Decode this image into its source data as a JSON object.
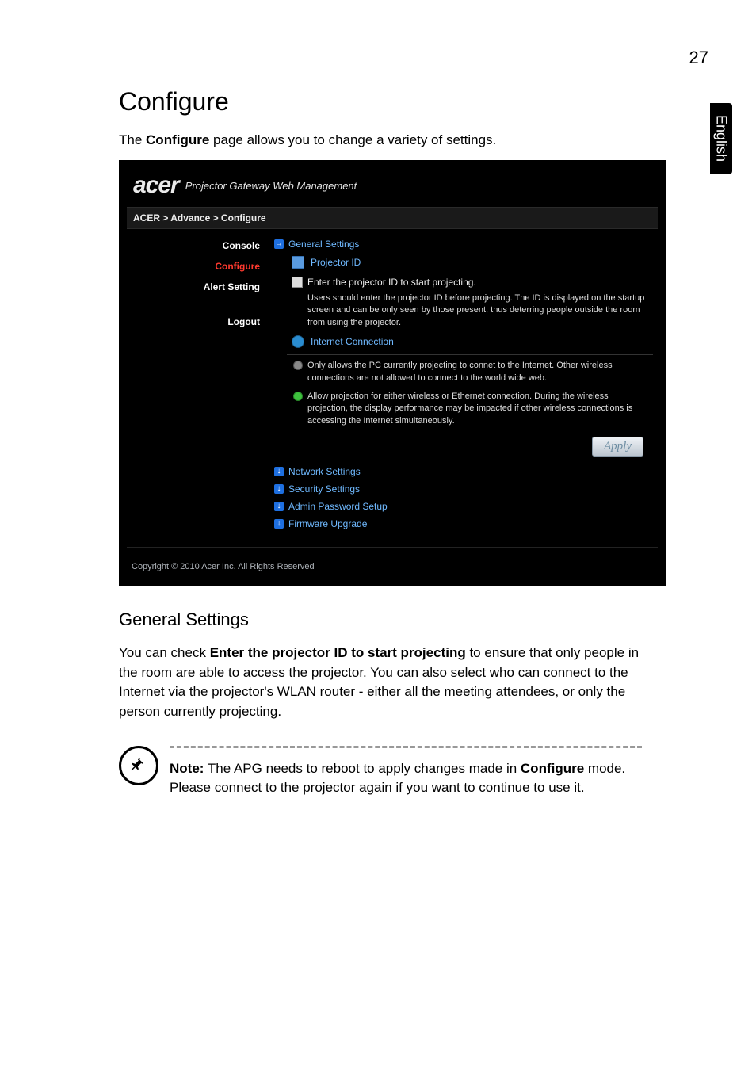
{
  "page_number": "27",
  "side_tab": "English",
  "title": "Configure",
  "intro_pre": "The ",
  "intro_bold": "Configure",
  "intro_post": " page allows you to change a variety of settings.",
  "webui": {
    "logo": "acer",
    "subtitle": "Projector Gateway Web Management",
    "breadcrumb": "ACER > Advance > Configure",
    "nav": {
      "console": "Console",
      "configure": "Configure",
      "alert": "Alert Setting",
      "logout": "Logout"
    },
    "sections": {
      "general": "General Settings",
      "projector_id": "Projector ID",
      "opt_checkbox": "Enter the projector ID to start projecting.",
      "opt_checkbox_detail": "Users should enter the projector ID before projecting. The ID is displayed on the startup screen and can be only seen by those present, thus deterring people outside the room from using the projector.",
      "internet": "Internet Connection",
      "radio1": "Only allows the PC currently projecting to connet to the Internet. Other wireless connections are not allowed to connect to the world wide web.",
      "radio2": "Allow projection for either wireless or Ethernet connection. During the wireless projection, the display performance may be impacted if other wireless connections is accessing the Internet simultaneously.",
      "apply": "Apply",
      "network": "Network Settings",
      "security": "Security Settings",
      "admin": "Admin Password Setup",
      "firmware": "Firmware Upgrade"
    },
    "footer": "Copyright © 2010 Acer Inc. All Rights Reserved"
  },
  "general_settings_heading": "General Settings",
  "body_pre": "You can check ",
  "body_bold": "Enter the projector ID to start projecting",
  "body_post": " to ensure that only people in the room are able to access the projector. You can also select who can connect to the Internet via the projector's WLAN router - either all the meeting attendees, or only the person currently projecting.",
  "note_label": "Note:",
  "note_part1": " The APG needs to reboot to apply changes made in ",
  "note_bold": "Configure",
  "note_part2": " mode. Please connect to the projector again if you want to continue to use it."
}
